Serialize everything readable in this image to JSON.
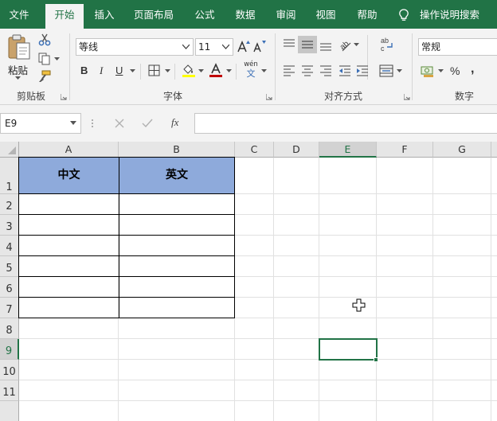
{
  "ribbon": {
    "tabs": [
      {
        "label": "文件"
      },
      {
        "label": "开始"
      },
      {
        "label": "插入"
      },
      {
        "label": "页面布局"
      },
      {
        "label": "公式"
      },
      {
        "label": "数据"
      },
      {
        "label": "审阅"
      },
      {
        "label": "视图"
      },
      {
        "label": "帮助"
      }
    ],
    "active_tab": "开始",
    "tell_me": "操作说明搜索",
    "groups": {
      "clipboard": {
        "label": "剪贴板",
        "paste_label": "粘贴"
      },
      "font": {
        "label": "字体",
        "font_name": "等线",
        "font_size": "11",
        "phonetic_top": "wén",
        "phonetic_bottom": "文"
      },
      "alignment": {
        "label": "对齐方式"
      },
      "number": {
        "label": "数字",
        "format": "常规"
      }
    },
    "font_color": "#c00000",
    "fill_color": "#ffff00"
  },
  "formula_bar": {
    "name_box": "E9",
    "fx_label": "fx",
    "formula": ""
  },
  "sheet": {
    "columns": [
      "A",
      "B",
      "C",
      "D",
      "E",
      "F",
      "G"
    ],
    "rows": [
      "1",
      "2",
      "3",
      "4",
      "5",
      "6",
      "7",
      "8",
      "9",
      "10",
      "11"
    ],
    "selected_column": "E",
    "selected_row": "9",
    "table": {
      "headers": [
        "中文",
        "英文"
      ],
      "header_fill": "#8eaadb",
      "body_rows": 6
    }
  },
  "colors": {
    "accent": "#217346"
  }
}
